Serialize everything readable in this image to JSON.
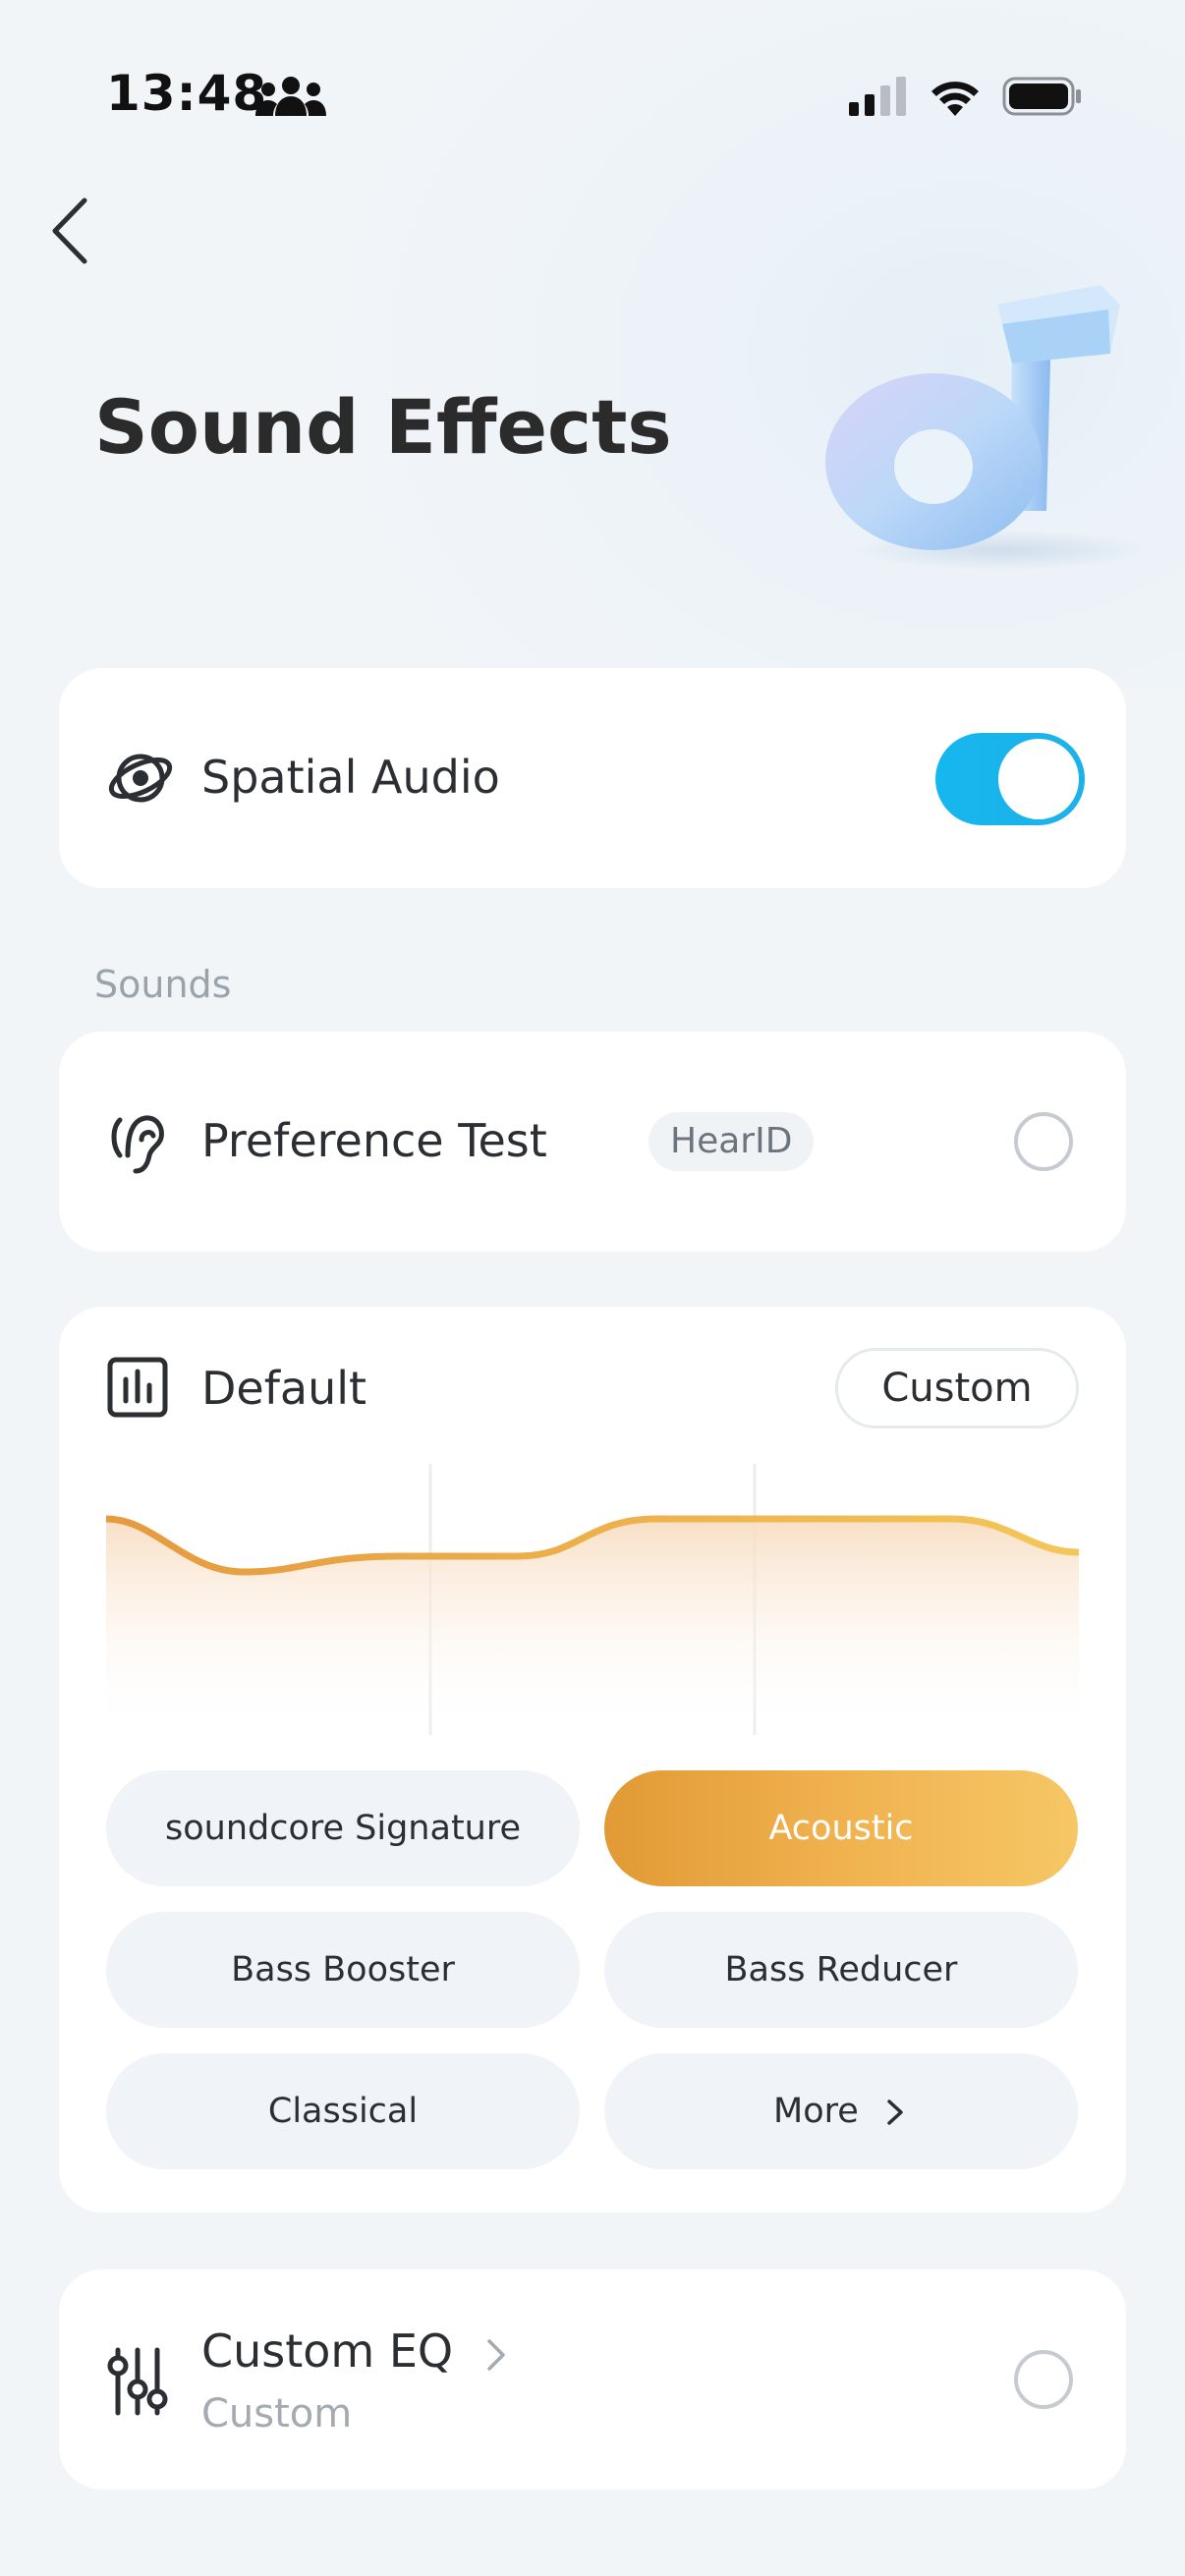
{
  "status_bar": {
    "time": "13:48",
    "icons": [
      "people-icon",
      "signal-icon",
      "wifi-icon",
      "battery-icon"
    ]
  },
  "header": {
    "title": "Sound Effects",
    "back_icon": "chevron-left-icon"
  },
  "spatial_audio": {
    "label": "Spatial Audio",
    "icon": "spatial-audio-icon",
    "enabled": true,
    "accent": "#16b7ee"
  },
  "sounds_section": {
    "label": "Sounds"
  },
  "preference_test": {
    "label": "Preference Test",
    "badge": "HearID",
    "icon": "ear-icon",
    "selected": false
  },
  "eq_card": {
    "label": "Default",
    "icon": "equalizer-icon",
    "custom_button": "Custom",
    "curve_color": "#e8a640",
    "presets": [
      {
        "label": "soundcore Signature",
        "active": false
      },
      {
        "label": "Acoustic",
        "active": true
      },
      {
        "label": "Bass Booster",
        "active": false
      },
      {
        "label": "Bass Reducer",
        "active": false
      },
      {
        "label": "Classical",
        "active": false
      },
      {
        "label": "More",
        "active": false
      }
    ]
  },
  "custom_eq": {
    "label": "Custom EQ",
    "sub_label": "Custom",
    "icon": "sliders-icon",
    "selected": false
  }
}
